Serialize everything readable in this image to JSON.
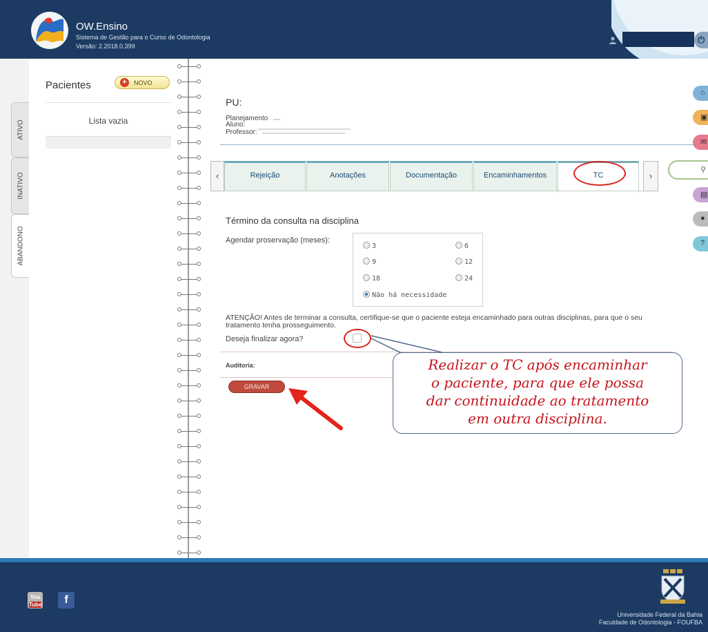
{
  "app": {
    "title": "OW.Ensino",
    "subtitle": "Sistema de Gestão para o Curso de Odontologia",
    "version": "Versão: 2.2018.0.399"
  },
  "left_tabs": [
    {
      "label": "ATIVO"
    },
    {
      "label": "INATIVO"
    },
    {
      "label": "ABANDONO"
    }
  ],
  "patients": {
    "title": "Pacientes",
    "new_button": "NOVO",
    "empty_text": "Lista vazia"
  },
  "record": {
    "pu_label": "PU:",
    "planning_label": "Planejamento",
    "student_label": "Aluno:",
    "professor_label": "Professor:"
  },
  "tabs": [
    {
      "label": "Rejeição"
    },
    {
      "label": "Anotações"
    },
    {
      "label": "Documentação"
    },
    {
      "label": "Encaminhamentos"
    },
    {
      "label": "TC"
    }
  ],
  "form": {
    "section_title": "Término da consulta na disciplina",
    "schedule_label": "Agendar proservação (meses):",
    "options": [
      {
        "label": "3",
        "selected": false
      },
      {
        "label": "6",
        "selected": false
      },
      {
        "label": "9",
        "selected": false
      },
      {
        "label": "12",
        "selected": false
      },
      {
        "label": "18",
        "selected": false
      },
      {
        "label": "24",
        "selected": false
      },
      {
        "label": "Não há necessidade",
        "selected": true
      }
    ],
    "warning": "ATENÇÃO! Antes de terminar a consulta, certifique-se que o paciente esteja encaminhado para outras disciplinas, para que o seu tratamento tenha prosseguimento.",
    "finalize_label": "Deseja finalizar agora?",
    "audit_label": "Auditoria:",
    "save_button": "GRAVAR"
  },
  "callout": {
    "line1": "Realizar o TC após encaminhar",
    "line2": "o paciente, para que ele possa",
    "line3": "dar continuidade ao tratamento",
    "line4": "em outra disciplina."
  },
  "side_icons": [
    {
      "icon": "home-icon",
      "color": "#7fb3d5"
    },
    {
      "icon": "calendar-icon",
      "color": "#f0b35a"
    },
    {
      "icon": "mail-icon",
      "color": "#e67a8c"
    },
    {
      "icon": "search-icon",
      "color": "#a8c48a"
    },
    {
      "icon": "report-icon",
      "color": "#c9a2d6"
    },
    {
      "icon": "user-icon",
      "color": "#bbbbbb"
    },
    {
      "icon": "help-icon",
      "color": "#7fc7d9"
    }
  ],
  "footer": {
    "university": "Universidade Federal da Bahia",
    "faculty": "Faculdade de Odontologia - FOUFBA",
    "youtube_you": "You",
    "youtube_tube": "Tube",
    "facebook": "f"
  },
  "colors": {
    "header_bg": "#1c3a62",
    "accent_red": "#d9241b",
    "tab_text": "#1c4a78",
    "save_button": "#c04a3e"
  }
}
